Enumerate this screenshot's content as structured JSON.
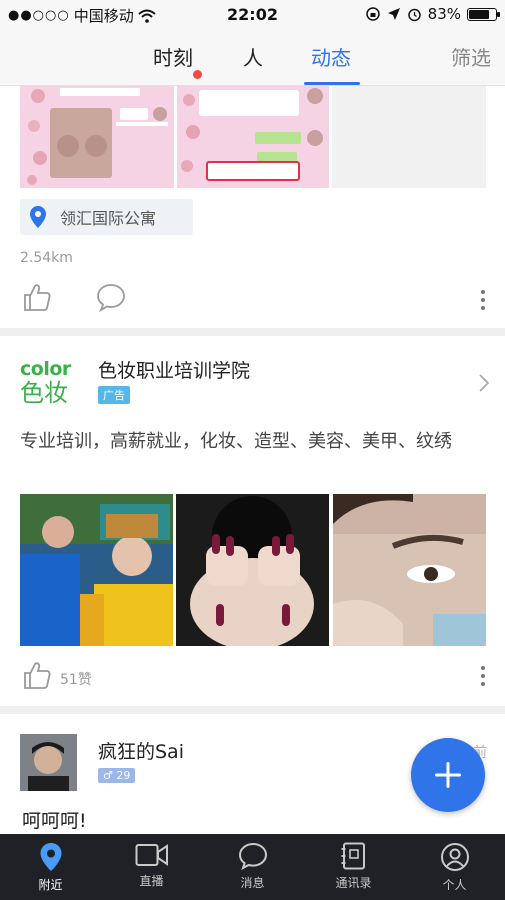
{
  "status_bar": {
    "carrier": "中国移动",
    "time": "22:02",
    "battery": "83%",
    "battery_level": 0.83
  },
  "top_nav": {
    "tabs": [
      {
        "label": "时刻",
        "has_badge": true
      },
      {
        "label": "人"
      },
      {
        "label": "动态",
        "active": true
      }
    ],
    "filter_label": "筛选"
  },
  "post1": {
    "location": "领汇国际公寓",
    "distance": "2.54km"
  },
  "ad_post": {
    "advertiser": "色妆职业培训学院",
    "badge": "广告",
    "logo_text_top": "color",
    "logo_text_bottom": "色妆",
    "text": "专业培训，高薪就业，化妆、造型、美容、美甲、纹绣",
    "likes": "51赞"
  },
  "post3": {
    "username": "疯狂的Sai",
    "gender_age": "♂ 29",
    "time": "前",
    "text": "呵呵呵!"
  },
  "bottom_tabs": [
    {
      "label": "附近",
      "icon": "location-icon",
      "active": true
    },
    {
      "label": "直播",
      "icon": "video-camera-icon"
    },
    {
      "label": "消息",
      "icon": "chat-bubble-icon"
    },
    {
      "label": "通讯录",
      "icon": "contacts-book-icon"
    },
    {
      "label": "个人",
      "icon": "profile-icon"
    }
  ],
  "colors": {
    "accent": "#2f74e8",
    "badge_red": "#f24b3f",
    "ad_badge": "#53b8e8",
    "tab_bar": "#1f2126"
  }
}
